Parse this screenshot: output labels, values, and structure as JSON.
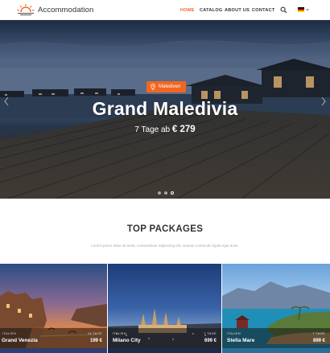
{
  "header": {
    "logo_text": "Accommodation",
    "nav": [
      {
        "label": "HOME",
        "active": true
      },
      {
        "label": "CATALOG",
        "active": false
      },
      {
        "label": "ABOUT US",
        "active": false
      },
      {
        "label": "CONTACT",
        "active": false
      }
    ],
    "search_icon": "search-icon",
    "language_flag": "german-flag"
  },
  "hero": {
    "location": "Malediven",
    "title": "Grand Maledivia",
    "subtitle_prefix": "7 Tage ab",
    "price": "€ 279",
    "slides": 3,
    "active_slide": 3
  },
  "packages": {
    "title": "TOP PACKAGES",
    "subtitle": "Lorem ipsum dolor sit amet, consectetuer adipiscing elit. Aenean commodo ligula eget dolor.",
    "items": [
      {
        "country": "ITALIEN",
        "name": "Grand Venezia",
        "duration": "14 TAGE",
        "price": "199 €"
      },
      {
        "country": "ITALIEN",
        "name": "Milano City",
        "duration": "7 TAGE",
        "price": "699 €"
      },
      {
        "country": "ITALIEN",
        "name": "Stella Mare",
        "duration": "7 TAGE",
        "price": "899 €"
      }
    ]
  },
  "colors": {
    "accent": "#f26522",
    "text": "#333333"
  }
}
